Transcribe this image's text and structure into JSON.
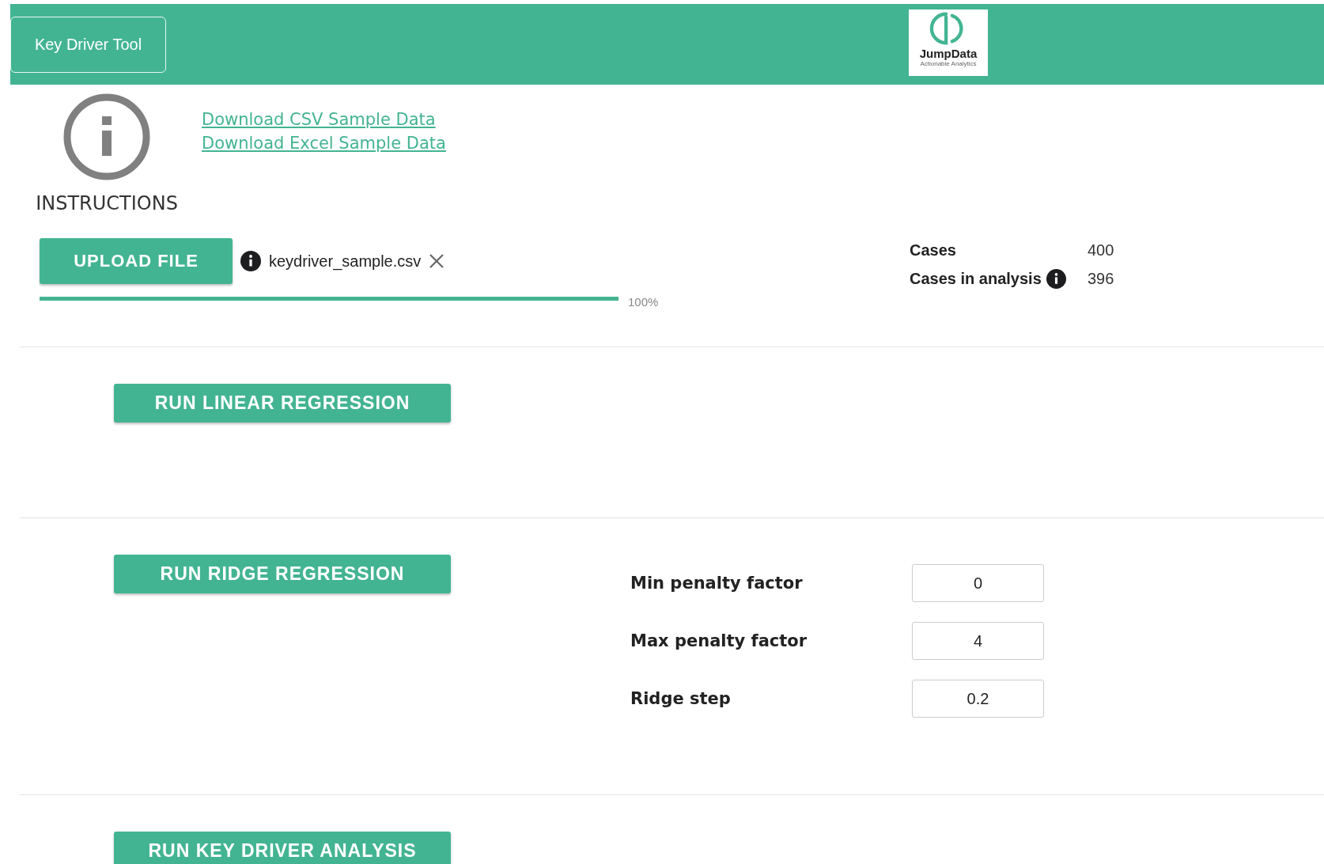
{
  "header": {
    "title_button": "Key Driver Tool",
    "logo": {
      "name": "JumpData",
      "tagline": "Actionable Analytics"
    }
  },
  "instructions": {
    "label": "INSTRUCTIONS",
    "links": [
      "Download CSV Sample Data",
      "Download Excel Sample Data"
    ]
  },
  "upload": {
    "button": "UPLOAD FILE",
    "file_name": "keydriver_sample.csv",
    "progress": {
      "level": 1,
      "label": "100%"
    }
  },
  "stats": [
    {
      "label": "Cases",
      "value": "400",
      "info": false
    },
    {
      "label": "Cases in analysis",
      "value": "396",
      "info": true
    }
  ],
  "sections": [
    {
      "button": "RUN LINEAR REGRESSION"
    },
    {
      "button": "RUN RIDGE REGRESSION",
      "params": [
        {
          "label": "Min penalty factor",
          "value": "0"
        },
        {
          "label": "Max penalty factor",
          "value": "4"
        },
        {
          "label": "Ridge step",
          "value": "0.2"
        }
      ]
    },
    {
      "button": "RUN KEY DRIVER ANALYSIS"
    }
  ]
}
